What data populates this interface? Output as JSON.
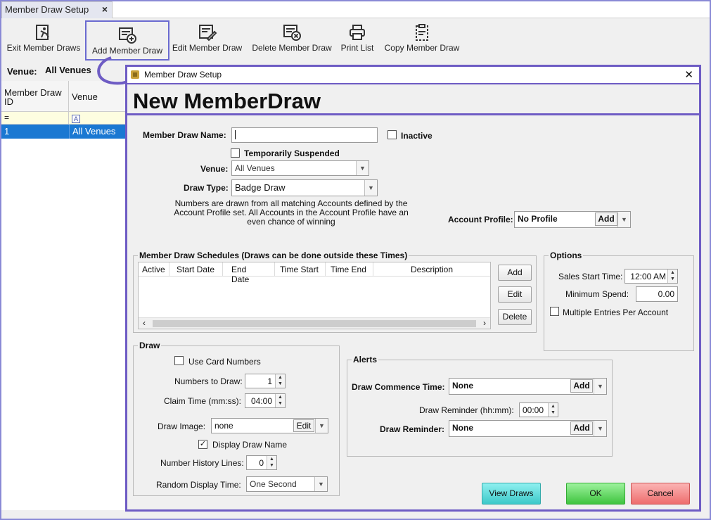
{
  "tab": {
    "title": "Member Draw Setup",
    "close": "×"
  },
  "toolbar": {
    "exit": "Exit Member Draws",
    "add": "Add Member Draw",
    "edit": "Edit Member Draw",
    "delete": "Delete Member Draw",
    "print": "Print List",
    "copy": "Copy Member Draw"
  },
  "venue_filter": {
    "label": "Venue:",
    "value": "All Venues"
  },
  "grid": {
    "columns": [
      "Member Draw ID",
      "Venue"
    ],
    "filter_row": [
      "=",
      "A"
    ],
    "rows": [
      {
        "id": "1",
        "venue": "All Venues"
      }
    ]
  },
  "dialog": {
    "title": "Member Draw Setup",
    "close": "✕",
    "heading": "New MemberDraw",
    "name_label": "Member Draw Name:",
    "name_value": "",
    "inactive_label": "Inactive",
    "temp_suspended_label": "Temporarily Suspended",
    "venue_label": "Venue:",
    "venue_value": "All Venues",
    "draw_type_label": "Draw Type:",
    "draw_type_value": "Badge Draw",
    "draw_type_desc": "Numbers are drawn from all matching Accounts defined by the Account Profile set. All Accounts in the Account Profile have an even chance of winning",
    "account_profile_label": "Account Profile:",
    "account_profile_value": "No Profile",
    "add_label": "Add",
    "schedules": {
      "caption": "Member Draw Schedules (Draws can be done outside these Times)",
      "columns": [
        "Active",
        "Start Date",
        "End Date",
        "Time Start",
        "Time End",
        "Description"
      ],
      "add": "Add",
      "edit": "Edit",
      "delete": "Delete"
    },
    "options": {
      "caption": "Options",
      "sales_start_label": "Sales Start Time:",
      "sales_start_value": "12:00 AM",
      "min_spend_label": "Minimum Spend:",
      "min_spend_value": "0.00",
      "multi_entries_label": "Multiple Entries Per Account"
    },
    "draw": {
      "caption": "Draw",
      "use_card_numbers": "Use Card Numbers",
      "numbers_to_draw_label": "Numbers to Draw:",
      "numbers_to_draw_value": "1",
      "claim_time_label": "Claim Time (mm:ss):",
      "claim_time_value": "04:00",
      "draw_image_label": "Draw Image:",
      "draw_image_value": "none",
      "edit_label": "Edit",
      "display_draw_name": "Display Draw Name",
      "history_lines_label": "Number History Lines:",
      "history_lines_value": "0",
      "random_display_label": "Random Display Time:",
      "random_display_value": "One Second"
    },
    "alerts": {
      "caption": "Alerts",
      "commence_label": "Draw Commence Time:",
      "commence_value": "None",
      "reminder_hhmm_label": "Draw Reminder (hh:mm):",
      "reminder_hhmm_value": "00:00",
      "reminder_label": "Draw Reminder:",
      "reminder_value": "None"
    },
    "buttons": {
      "view_draws": "View Draws",
      "ok": "OK",
      "cancel": "Cancel"
    }
  },
  "colors": {
    "accent": "#6e5cc4",
    "selected_row": "#1a78d2",
    "ok": "#4fcf4f",
    "cancel": "#f37b7b",
    "view_draws": "#4fd6d6"
  }
}
